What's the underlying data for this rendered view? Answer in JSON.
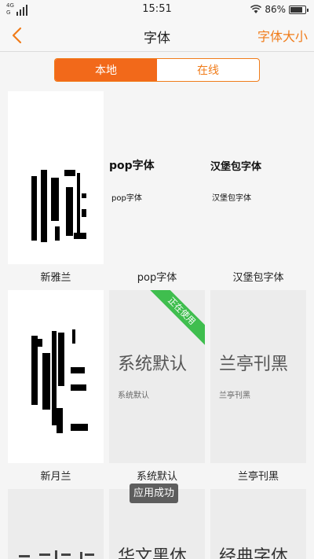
{
  "status_bar": {
    "network_1": "4G",
    "network_2": "G",
    "time": "15:51",
    "battery_percent": "86%",
    "battery_level": 0.86
  },
  "nav": {
    "back_icon": "chevron-left-icon",
    "title": "字体",
    "action_label": "字体大小"
  },
  "tabs": [
    {
      "label": "本地",
      "active": true
    },
    {
      "label": "在线",
      "active": false
    }
  ],
  "fonts": [
    {
      "name": "新雅兰",
      "preview_big": "",
      "preview_small": ""
    },
    {
      "name": "pop字体",
      "preview_big": "pop字体",
      "preview_small": "pop字体"
    },
    {
      "name": "汉堡包字体",
      "preview_big": "汉堡包字体",
      "preview_small": "汉堡包字体"
    },
    {
      "name": "新月兰",
      "preview_big": "",
      "preview_small": ""
    },
    {
      "name": "系统默认",
      "preview_big": "系统默认",
      "preview_small": "系统默认",
      "in_use_badge": "正在使用"
    },
    {
      "name": "兰亭刊黑",
      "preview_big": "兰亭刊黑",
      "preview_small": "兰亭刊黑"
    },
    {
      "name": "",
      "preview_big": "",
      "preview_small": ""
    },
    {
      "name": "",
      "preview_big": "华文黑体",
      "preview_small": ""
    },
    {
      "name": "",
      "preview_big": "经典字体",
      "preview_small": ""
    }
  ],
  "toast": "应用成功",
  "colors": {
    "accent": "#f07c1a",
    "tab_active": "#f2691a",
    "badge": "#3fbe4e"
  }
}
